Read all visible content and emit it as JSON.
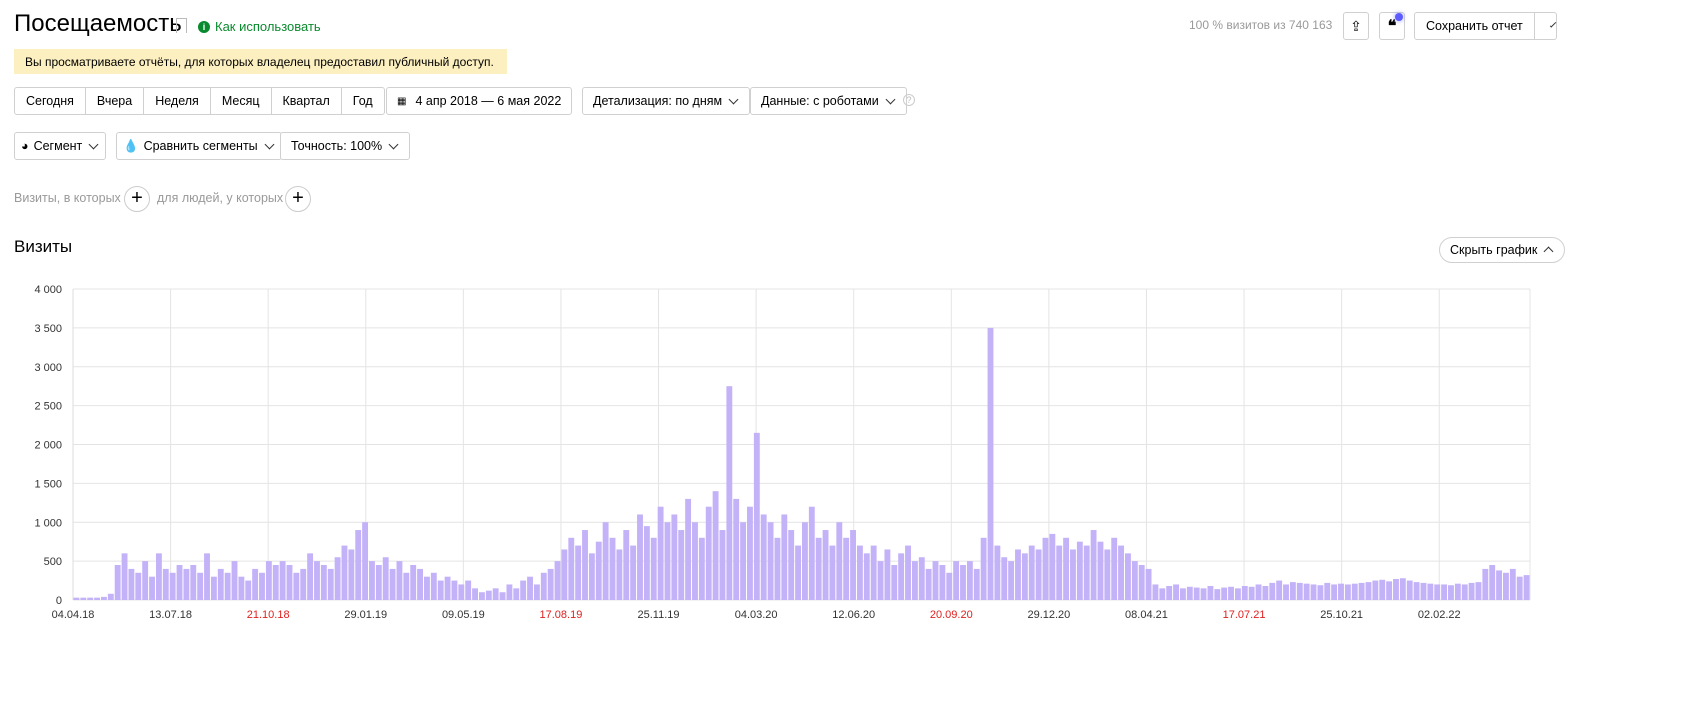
{
  "header": {
    "title": "Посещаемость",
    "help": "Как использовать",
    "visits_summary": "100 % визитов из 740 163",
    "save_report": "Сохранить отчет"
  },
  "notice": "Вы просматриваете отчёты, для которых владелец предоставил публичный доступ.",
  "periods": [
    "Сегодня",
    "Вчера",
    "Неделя",
    "Месяц",
    "Квартал",
    "Год"
  ],
  "date_range": "4 апр 2018 — 6 мая 2022",
  "detail": "Детализация: по дням",
  "data_mode": "Данные: с роботами",
  "segment": "Сегмент",
  "compare": "Сравнить сегменты",
  "accuracy": "Точность: 100%",
  "filters": {
    "visits_where": "Визиты, в которых",
    "people_where": "для людей, у которых"
  },
  "chart_section": {
    "title": "Визиты",
    "hide_button": "Скрыть график"
  },
  "colors": {
    "bar": "#c3b2f8",
    "weekend": "#e0201f",
    "help": "#0a8a2e"
  },
  "chart_data": {
    "type": "bar",
    "title": "Визиты",
    "ylim": [
      0,
      4000
    ],
    "yticks": [
      0,
      500,
      1000,
      1500,
      2000,
      2500,
      3000,
      3500,
      4000
    ],
    "ytick_labels": [
      "0",
      "500",
      "1 000",
      "1 500",
      "2 000",
      "2 500",
      "3 000",
      "3 500",
      "4 000"
    ],
    "total_days": 1493,
    "xticks": [
      {
        "label": "04.04.18",
        "day": 0,
        "weekend": false
      },
      {
        "label": "13.07.18",
        "day": 100,
        "weekend": false
      },
      {
        "label": "21.10.18",
        "day": 200,
        "weekend": true
      },
      {
        "label": "29.01.19",
        "day": 300,
        "weekend": false
      },
      {
        "label": "09.05.19",
        "day": 400,
        "weekend": false
      },
      {
        "label": "17.08.19",
        "day": 500,
        "weekend": true
      },
      {
        "label": "25.11.19",
        "day": 600,
        "weekend": false
      },
      {
        "label": "04.03.20",
        "day": 700,
        "weekend": false
      },
      {
        "label": "12.06.20",
        "day": 800,
        "weekend": false
      },
      {
        "label": "20.09.20",
        "day": 900,
        "weekend": true
      },
      {
        "label": "29.12.20",
        "day": 1000,
        "weekend": false
      },
      {
        "label": "08.04.21",
        "day": 1100,
        "weekend": false
      },
      {
        "label": "17.07.21",
        "day": 1200,
        "weekend": true
      },
      {
        "label": "25.10.21",
        "day": 1300,
        "weekend": false
      },
      {
        "label": "02.02.22",
        "day": 1400,
        "weekend": false
      }
    ],
    "bin": "week",
    "values": [
      30,
      30,
      30,
      30,
      40,
      80,
      450,
      600,
      400,
      350,
      500,
      300,
      600,
      400,
      350,
      450,
      400,
      450,
      350,
      600,
      300,
      400,
      350,
      500,
      300,
      250,
      400,
      350,
      500,
      450,
      500,
      450,
      350,
      400,
      600,
      500,
      450,
      400,
      550,
      700,
      650,
      900,
      1000,
      500,
      450,
      550,
      400,
      500,
      350,
      450,
      400,
      300,
      350,
      250,
      300,
      250,
      200,
      250,
      150,
      100,
      120,
      150,
      100,
      200,
      150,
      250,
      300,
      200,
      350,
      400,
      500,
      650,
      800,
      700,
      900,
      600,
      750,
      1000,
      800,
      650,
      900,
      700,
      1100,
      950,
      800,
      1200,
      1000,
      1100,
      900,
      1300,
      1000,
      800,
      1200,
      1400,
      900,
      2750,
      1300,
      1000,
      1200,
      2150,
      1100,
      1000,
      800,
      1100,
      900,
      700,
      1000,
      1200,
      800,
      900,
      700,
      1000,
      800,
      900,
      700,
      600,
      700,
      500,
      650,
      450,
      600,
      700,
      500,
      550,
      400,
      500,
      450,
      350,
      500,
      450,
      500,
      400,
      800,
      3500,
      700,
      550,
      500,
      650,
      600,
      700,
      650,
      800,
      850,
      700,
      800,
      650,
      750,
      700,
      900,
      750,
      650,
      800,
      700,
      600,
      500,
      450,
      400,
      200,
      150,
      180,
      200,
      150,
      170,
      160,
      150,
      180,
      140,
      160,
      170,
      150,
      180,
      170,
      200,
      180,
      220,
      250,
      200,
      230,
      220,
      210,
      200,
      190,
      220,
      200,
      210,
      200,
      210,
      220,
      230,
      250,
      260,
      240,
      270,
      280,
      250,
      230,
      220,
      210,
      200,
      200,
      190,
      210,
      200,
      220,
      230,
      400,
      450,
      380,
      350,
      400,
      300,
      320
    ]
  }
}
